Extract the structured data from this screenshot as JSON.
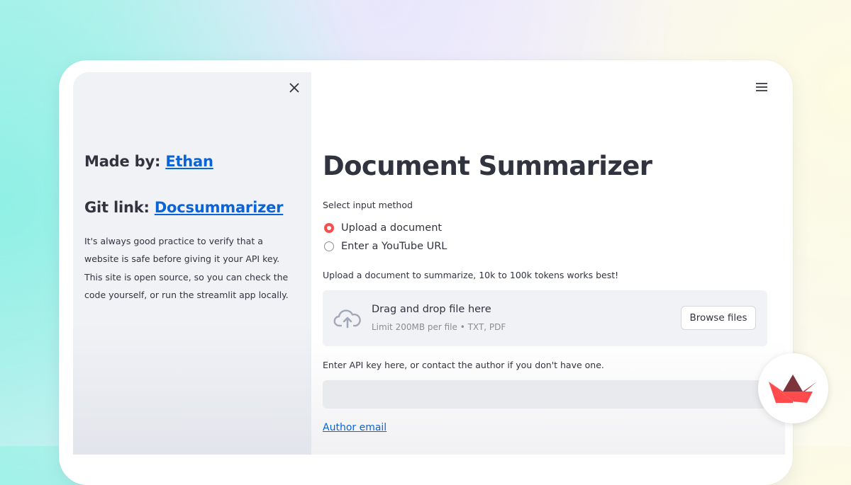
{
  "sidebar": {
    "made_by_label": "Made by:",
    "made_by_link": "Ethan",
    "git_label": "Git link:",
    "git_link": "Docsummarizer",
    "note": "It's always good practice to verify that a website is safe before giving it your API key. This site is open source, so you can check the code yourself, or run the streamlit app locally."
  },
  "main": {
    "title": "Document Summarizer",
    "input_method_label": "Select input method",
    "options": [
      {
        "label": "Upload a document",
        "selected": true
      },
      {
        "label": "Enter a YouTube URL",
        "selected": false
      }
    ],
    "upload_label": "Upload a document to summarize, 10k to 100k tokens works best!",
    "dropzone": {
      "title": "Drag and drop file here",
      "subtitle": "Limit 200MB per file • TXT, PDF",
      "button": "Browse files"
    },
    "api_label": "Enter API key here, or contact the author if you don't have one.",
    "api_value": "",
    "author_email": "Author email"
  },
  "icons": {
    "close": "close-icon",
    "menu": "hamburger-menu-icon",
    "upload": "cloud-upload-icon",
    "logo": "streamlit-logo"
  },
  "colors": {
    "accent": "#ff4b4b",
    "link": "#0b63d8",
    "sidebar_bg": "#f0f2f6",
    "text": "#31333f"
  }
}
